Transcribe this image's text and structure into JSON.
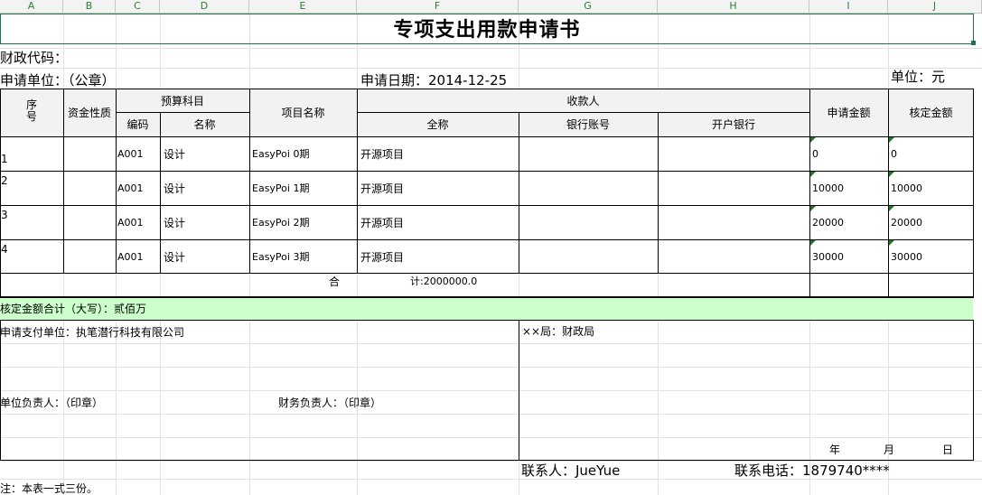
{
  "columns": [
    "A",
    "B",
    "C",
    "D",
    "E",
    "F",
    "G",
    "H",
    "I",
    "J"
  ],
  "title": "专项支出用款申请书",
  "finance_code_label": "财政代码：",
  "applicant_unit_label": "申请单位：（公章）",
  "apply_date_label": "申请日期：2014-12-25",
  "unit_label": "单位：元",
  "headers": {
    "seq": "序号",
    "fund_nature": "资金性质",
    "budget_subject": "预算科目",
    "code": "编码",
    "name": "名称",
    "project_name": "项目名称",
    "payee": "收款人",
    "full_name": "全称",
    "bank_account": "银行账号",
    "bank": "开户银行",
    "apply_amount": "申请金额",
    "approved_amount": "核定金额"
  },
  "rows": [
    {
      "seq": "1",
      "code": "A001",
      "name": "设计",
      "project": "EasyPoi 0期",
      "payee": "开源项目",
      "apply": "0",
      "approved": "0"
    },
    {
      "seq": "2",
      "code": "A001",
      "name": "设计",
      "project": "EasyPoi 1期",
      "payee": "开源项目",
      "apply": "10000",
      "approved": "10000"
    },
    {
      "seq": "3",
      "code": "A001",
      "name": "设计",
      "project": "EasyPoi 2期",
      "payee": "开源项目",
      "apply": "20000",
      "approved": "20000"
    },
    {
      "seq": "4",
      "code": "A001",
      "name": "设计",
      "project": "EasyPoi 3期",
      "payee": "开源项目",
      "apply": "30000",
      "approved": "30000"
    }
  ],
  "total_label": "合",
  "total_value": "计:2000000.0",
  "approved_total": "核定金额合计（大写）：贰佰万",
  "pay_unit": "申请支付单位：执笔潜行科技有限公司",
  "bureau": "××局：财政局",
  "unit_head": "单位负责人：（印章）",
  "finance_head": "财务负责人：（印章）",
  "date_year": "年",
  "date_month": "月",
  "date_day": "日",
  "contact": "联系人：JueYue",
  "phone": "联系电话：1879740****",
  "note": "注：本表一式三份。"
}
